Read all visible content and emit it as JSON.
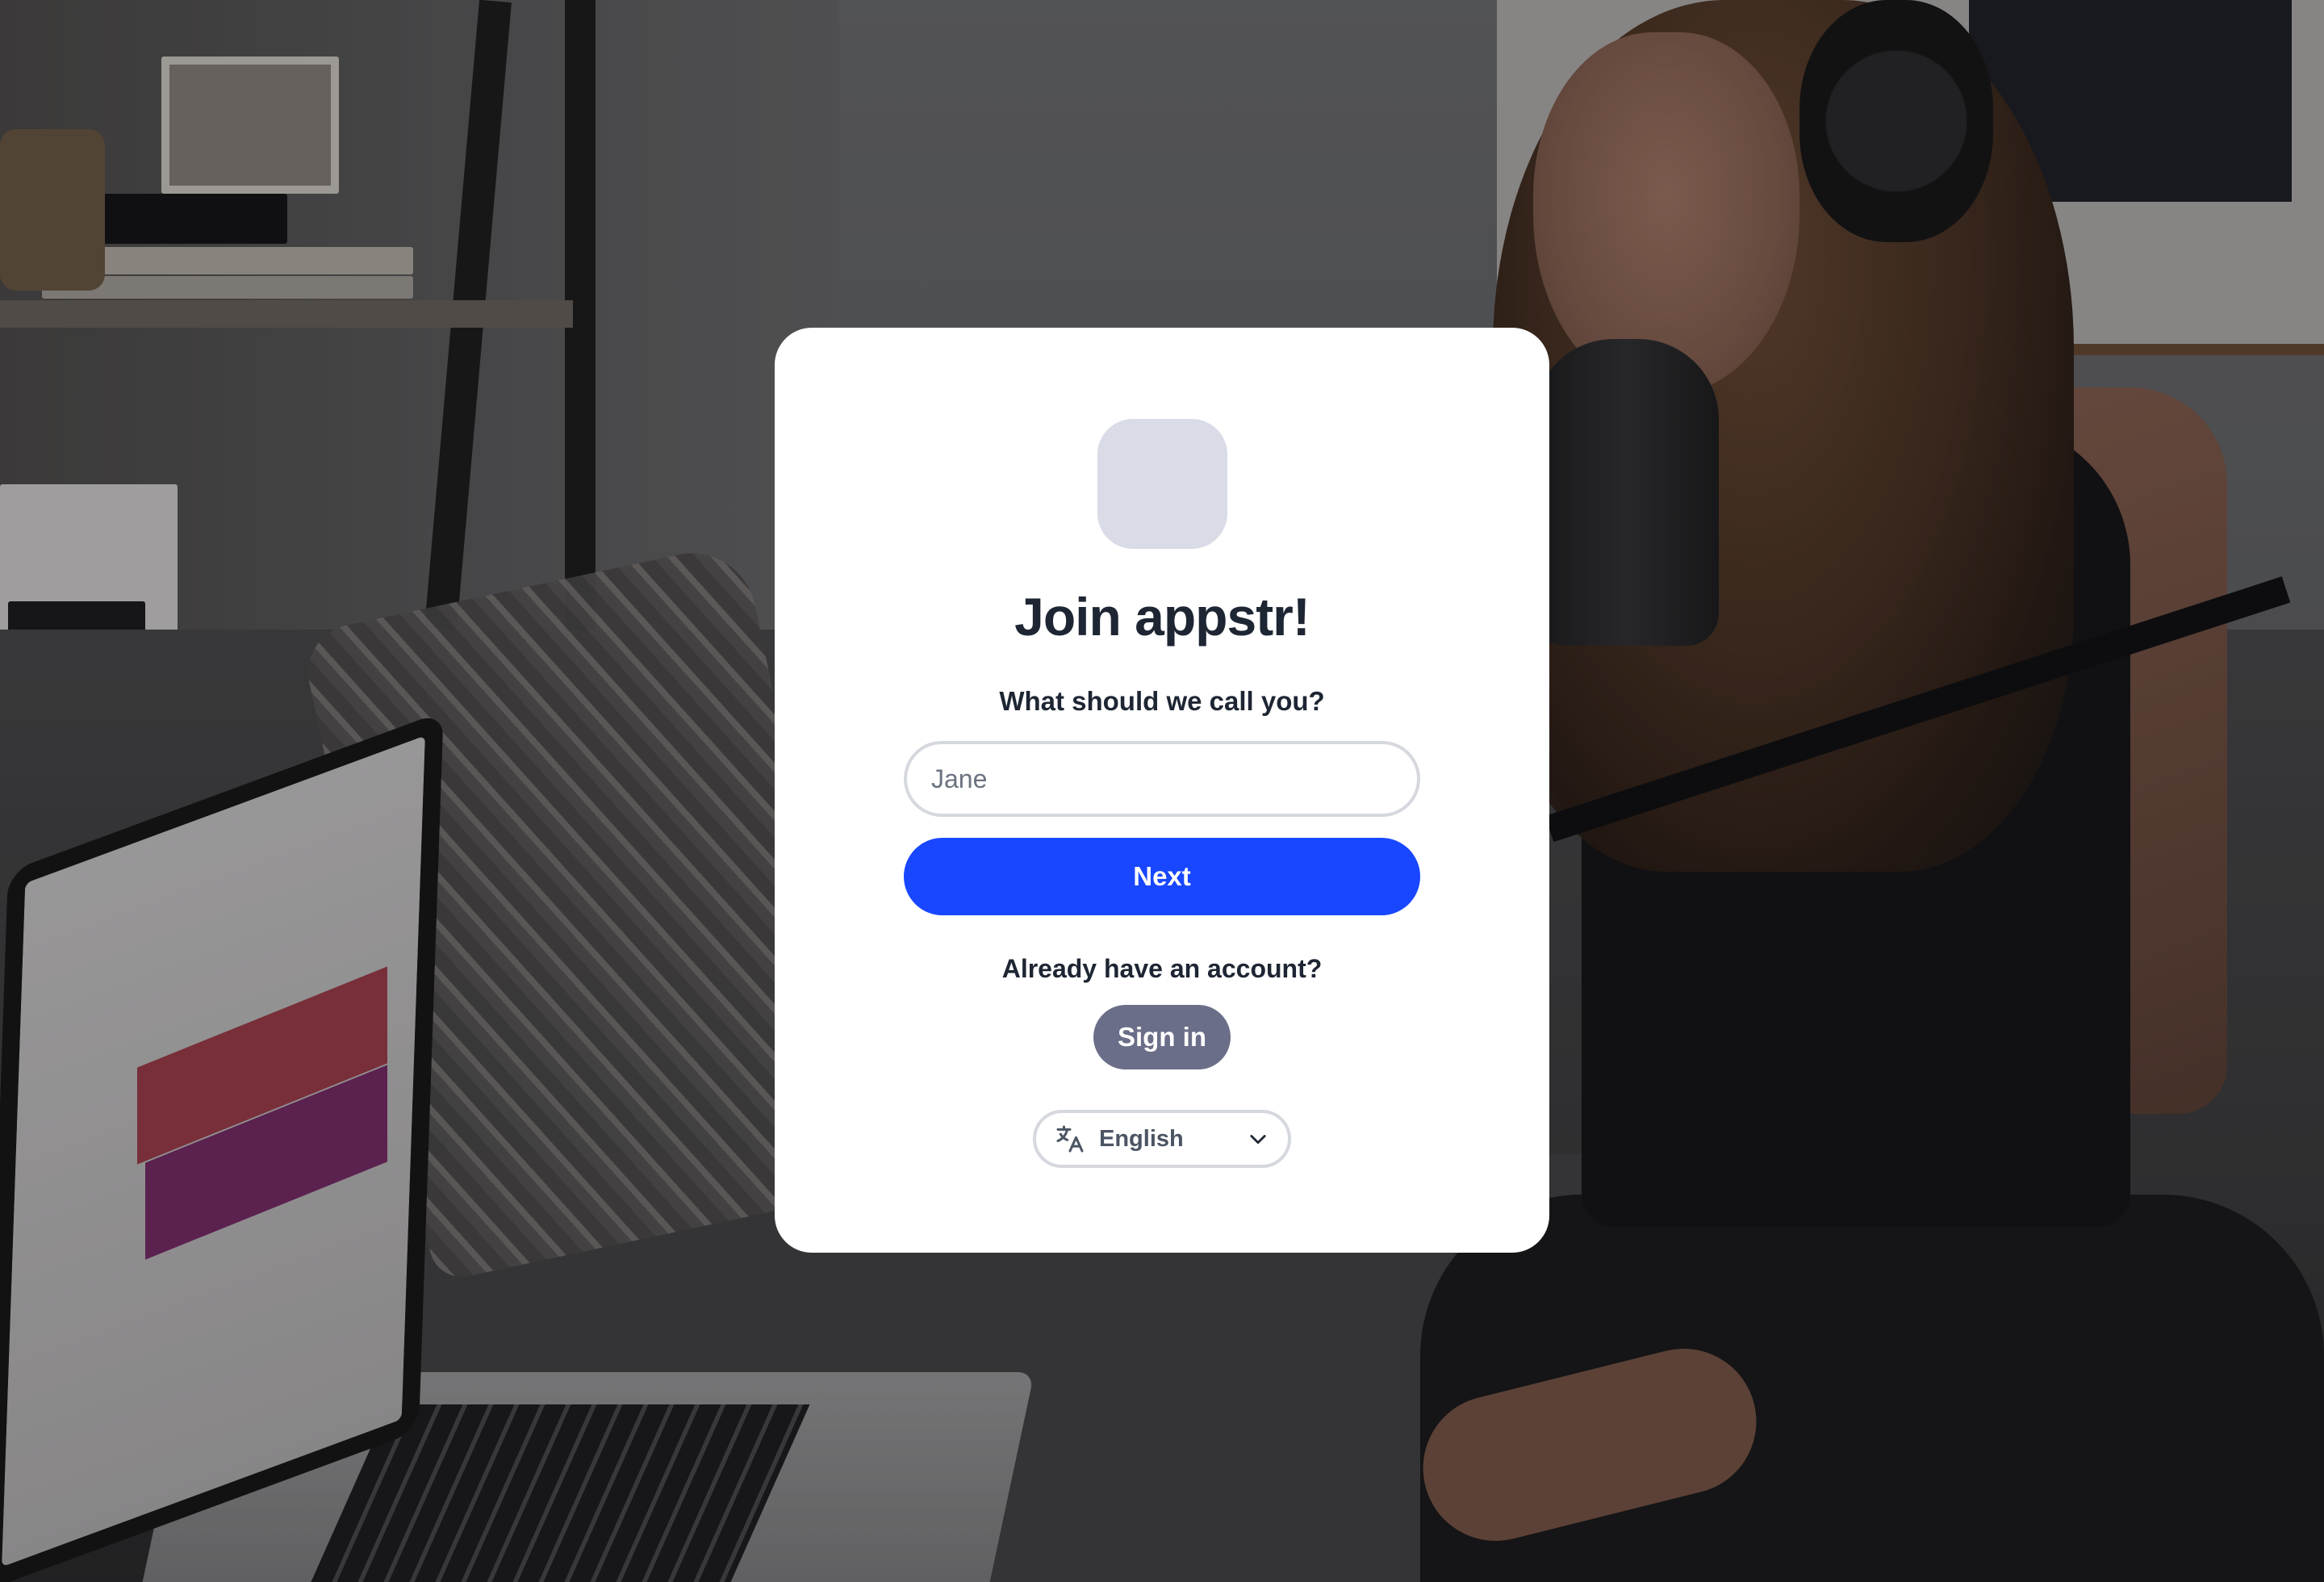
{
  "card": {
    "title": "Join appstr!",
    "name_prompt": "What should we call you?",
    "name_input": {
      "value": "",
      "placeholder": "Jane"
    },
    "next_label": "Next",
    "account_prompt": "Already have an account?",
    "signin_label": "Sign in",
    "language": {
      "selected": "English",
      "icon": "translate-icon"
    }
  },
  "colors": {
    "primary": "#1847ff",
    "secondary": "#6b6e88",
    "logo_placeholder": "#d9dbe6",
    "text": "#1e2533"
  }
}
